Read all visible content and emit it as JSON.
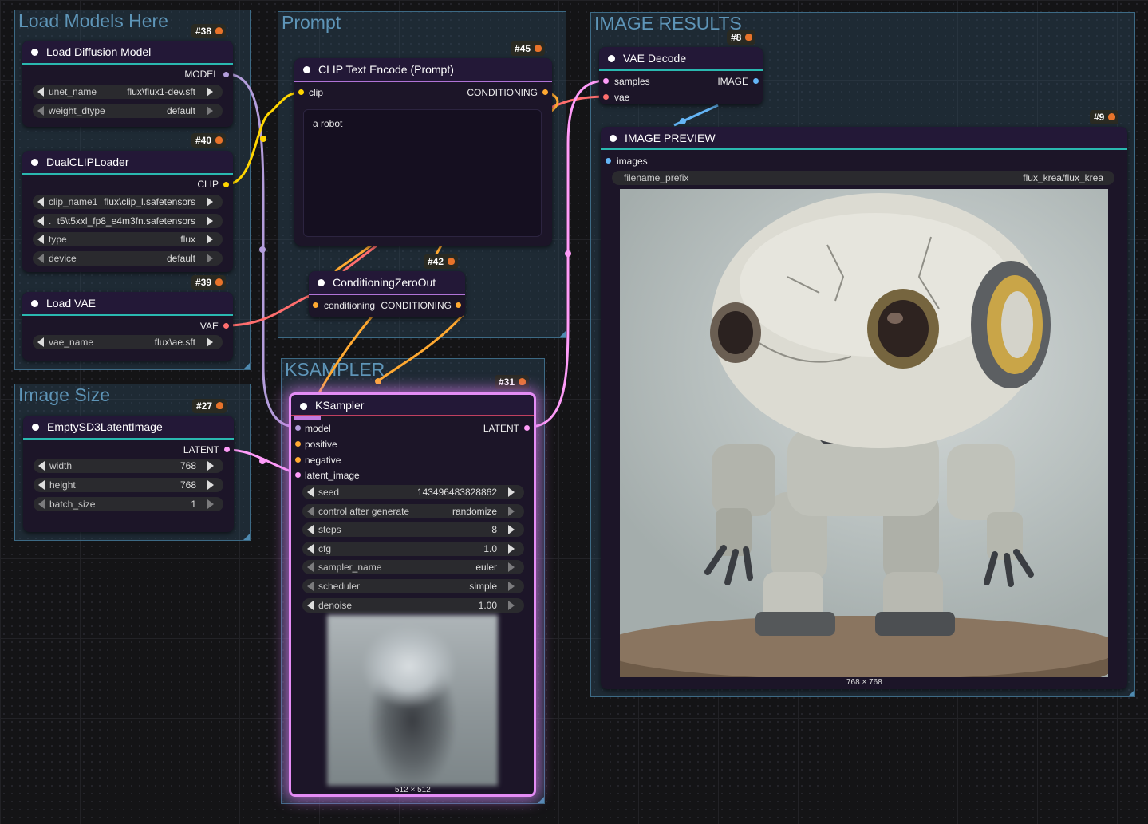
{
  "colors": {
    "group_bg": "#30546e",
    "node_bg": "#1c1528",
    "teal_line": "#2ab8b0",
    "purple_line": "#b073d6",
    "model_link": "#b39ddb",
    "clip_link": "#ffd500",
    "conditioning_link": "#ffa931",
    "vae_link": "#ff6e6e",
    "latent_link": "#ff9cf9",
    "image_link": "#64b5f6",
    "ksampler_highlight": "#e48cf5"
  },
  "groups": {
    "load_models": "Load Models Here",
    "image_size": "Image Size",
    "prompt": "Prompt",
    "ksampler": "KSAMPLER",
    "image_results": "IMAGE RESULTS"
  },
  "nodes": {
    "load_diffusion": {
      "badge": "#38",
      "title": "Load Diffusion Model",
      "output": "MODEL",
      "widgets": [
        {
          "label": "unet_name",
          "value": "flux\\flux1-dev.sft"
        },
        {
          "label": "weight_dtype",
          "value": "default"
        }
      ]
    },
    "dual_clip": {
      "badge": "#40",
      "title": "DualCLIPLoader",
      "output": "CLIP",
      "widgets": [
        {
          "label": "clip_name1",
          "value": "flux\\clip_l.safetensors"
        },
        {
          "label": ".",
          "value": "t5\\t5xxl_fp8_e4m3fn.safetensors"
        },
        {
          "label": "type",
          "value": "flux"
        },
        {
          "label": "device",
          "value": "default"
        }
      ]
    },
    "load_vae": {
      "badge": "#39",
      "title": "Load VAE",
      "output": "VAE",
      "widgets": [
        {
          "label": "vae_name",
          "value": "flux\\ae.sft"
        }
      ]
    },
    "empty_latent": {
      "badge": "#27",
      "title": "EmptySD3LatentImage",
      "output": "LATENT",
      "widgets": [
        {
          "label": "width",
          "value": "768"
        },
        {
          "label": "height",
          "value": "768"
        },
        {
          "label": "batch_size",
          "value": "1"
        }
      ]
    },
    "clip_text_encode": {
      "badge": "#45",
      "title": "CLIP Text Encode (Prompt)",
      "input": "clip",
      "output": "CONDITIONING",
      "text": "a robot"
    },
    "conditioning_zero": {
      "badge": "#42",
      "title": "ConditioningZeroOut",
      "input": "conditioning",
      "output": "CONDITIONING"
    },
    "ksampler": {
      "badge": "#31",
      "title": "KSampler",
      "inputs": [
        "model",
        "positive",
        "negative",
        "latent_image"
      ],
      "output": "LATENT",
      "widgets": [
        {
          "label": "seed",
          "value": "143496483828862"
        },
        {
          "label": "control after generate",
          "value": "randomize"
        },
        {
          "label": "steps",
          "value": "8"
        },
        {
          "label": "cfg",
          "value": "1.0"
        },
        {
          "label": "sampler_name",
          "value": "euler"
        },
        {
          "label": "scheduler",
          "value": "simple"
        },
        {
          "label": "denoise",
          "value": "1.00"
        }
      ],
      "preview_size": "512 × 512"
    },
    "vae_decode": {
      "badge": "#8",
      "title": "VAE Decode",
      "inputs": [
        "samples",
        "vae"
      ],
      "output": "IMAGE"
    },
    "image_preview": {
      "badge": "#9",
      "title": "IMAGE PREVIEW",
      "input": "images",
      "widget": {
        "label": "filename_prefix",
        "value": "flux_krea/flux_krea"
      },
      "image_size": "768 × 768"
    }
  }
}
